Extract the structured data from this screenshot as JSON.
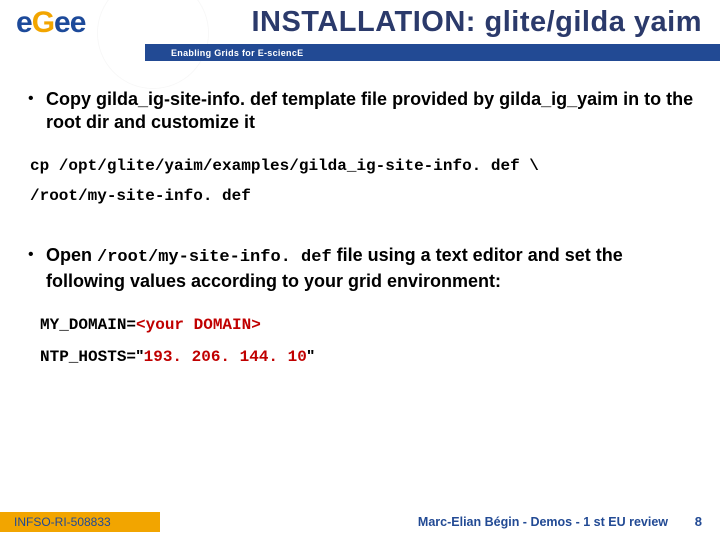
{
  "header": {
    "title": "INSTALLATION: glite/gilda yaim",
    "tagline": "Enabling Grids for E-sciencE",
    "logo_letters": {
      "e1": "e",
      "g": "G",
      "e2": "e",
      "e3": "e"
    }
  },
  "body": {
    "bullet1_pre": "Copy ",
    "bullet1_b1": "gilda_ig-site-info. def",
    "bullet1_mid": " template file provided by ",
    "bullet1_b2": "gilda_ig_yaim",
    "bullet1_post": " in to the root dir and customize it",
    "cmd1": "cp /opt/glite/yaim/examples/gilda_ig-site-info. def   \\",
    "cmd2": "/root/my-site-info. def",
    "bullet2_pre": "Open ",
    "bullet2_code": "/root/my-site-info. def",
    "bullet2_post": " file using a text editor and set the following values according to your grid environment:",
    "var1_key": "MY_DOMAIN=",
    "var1_val": "<your DOMAIN>",
    "var2_key": "NTP_HOSTS=",
    "var2_q1": "\"",
    "var2_val": "193. 206. 144. 10",
    "var2_q2": "\""
  },
  "footer": {
    "left": "INFSO-RI-508833",
    "right": "Marc-Elian Bégin - Demos - 1 st EU review",
    "page": "8"
  }
}
